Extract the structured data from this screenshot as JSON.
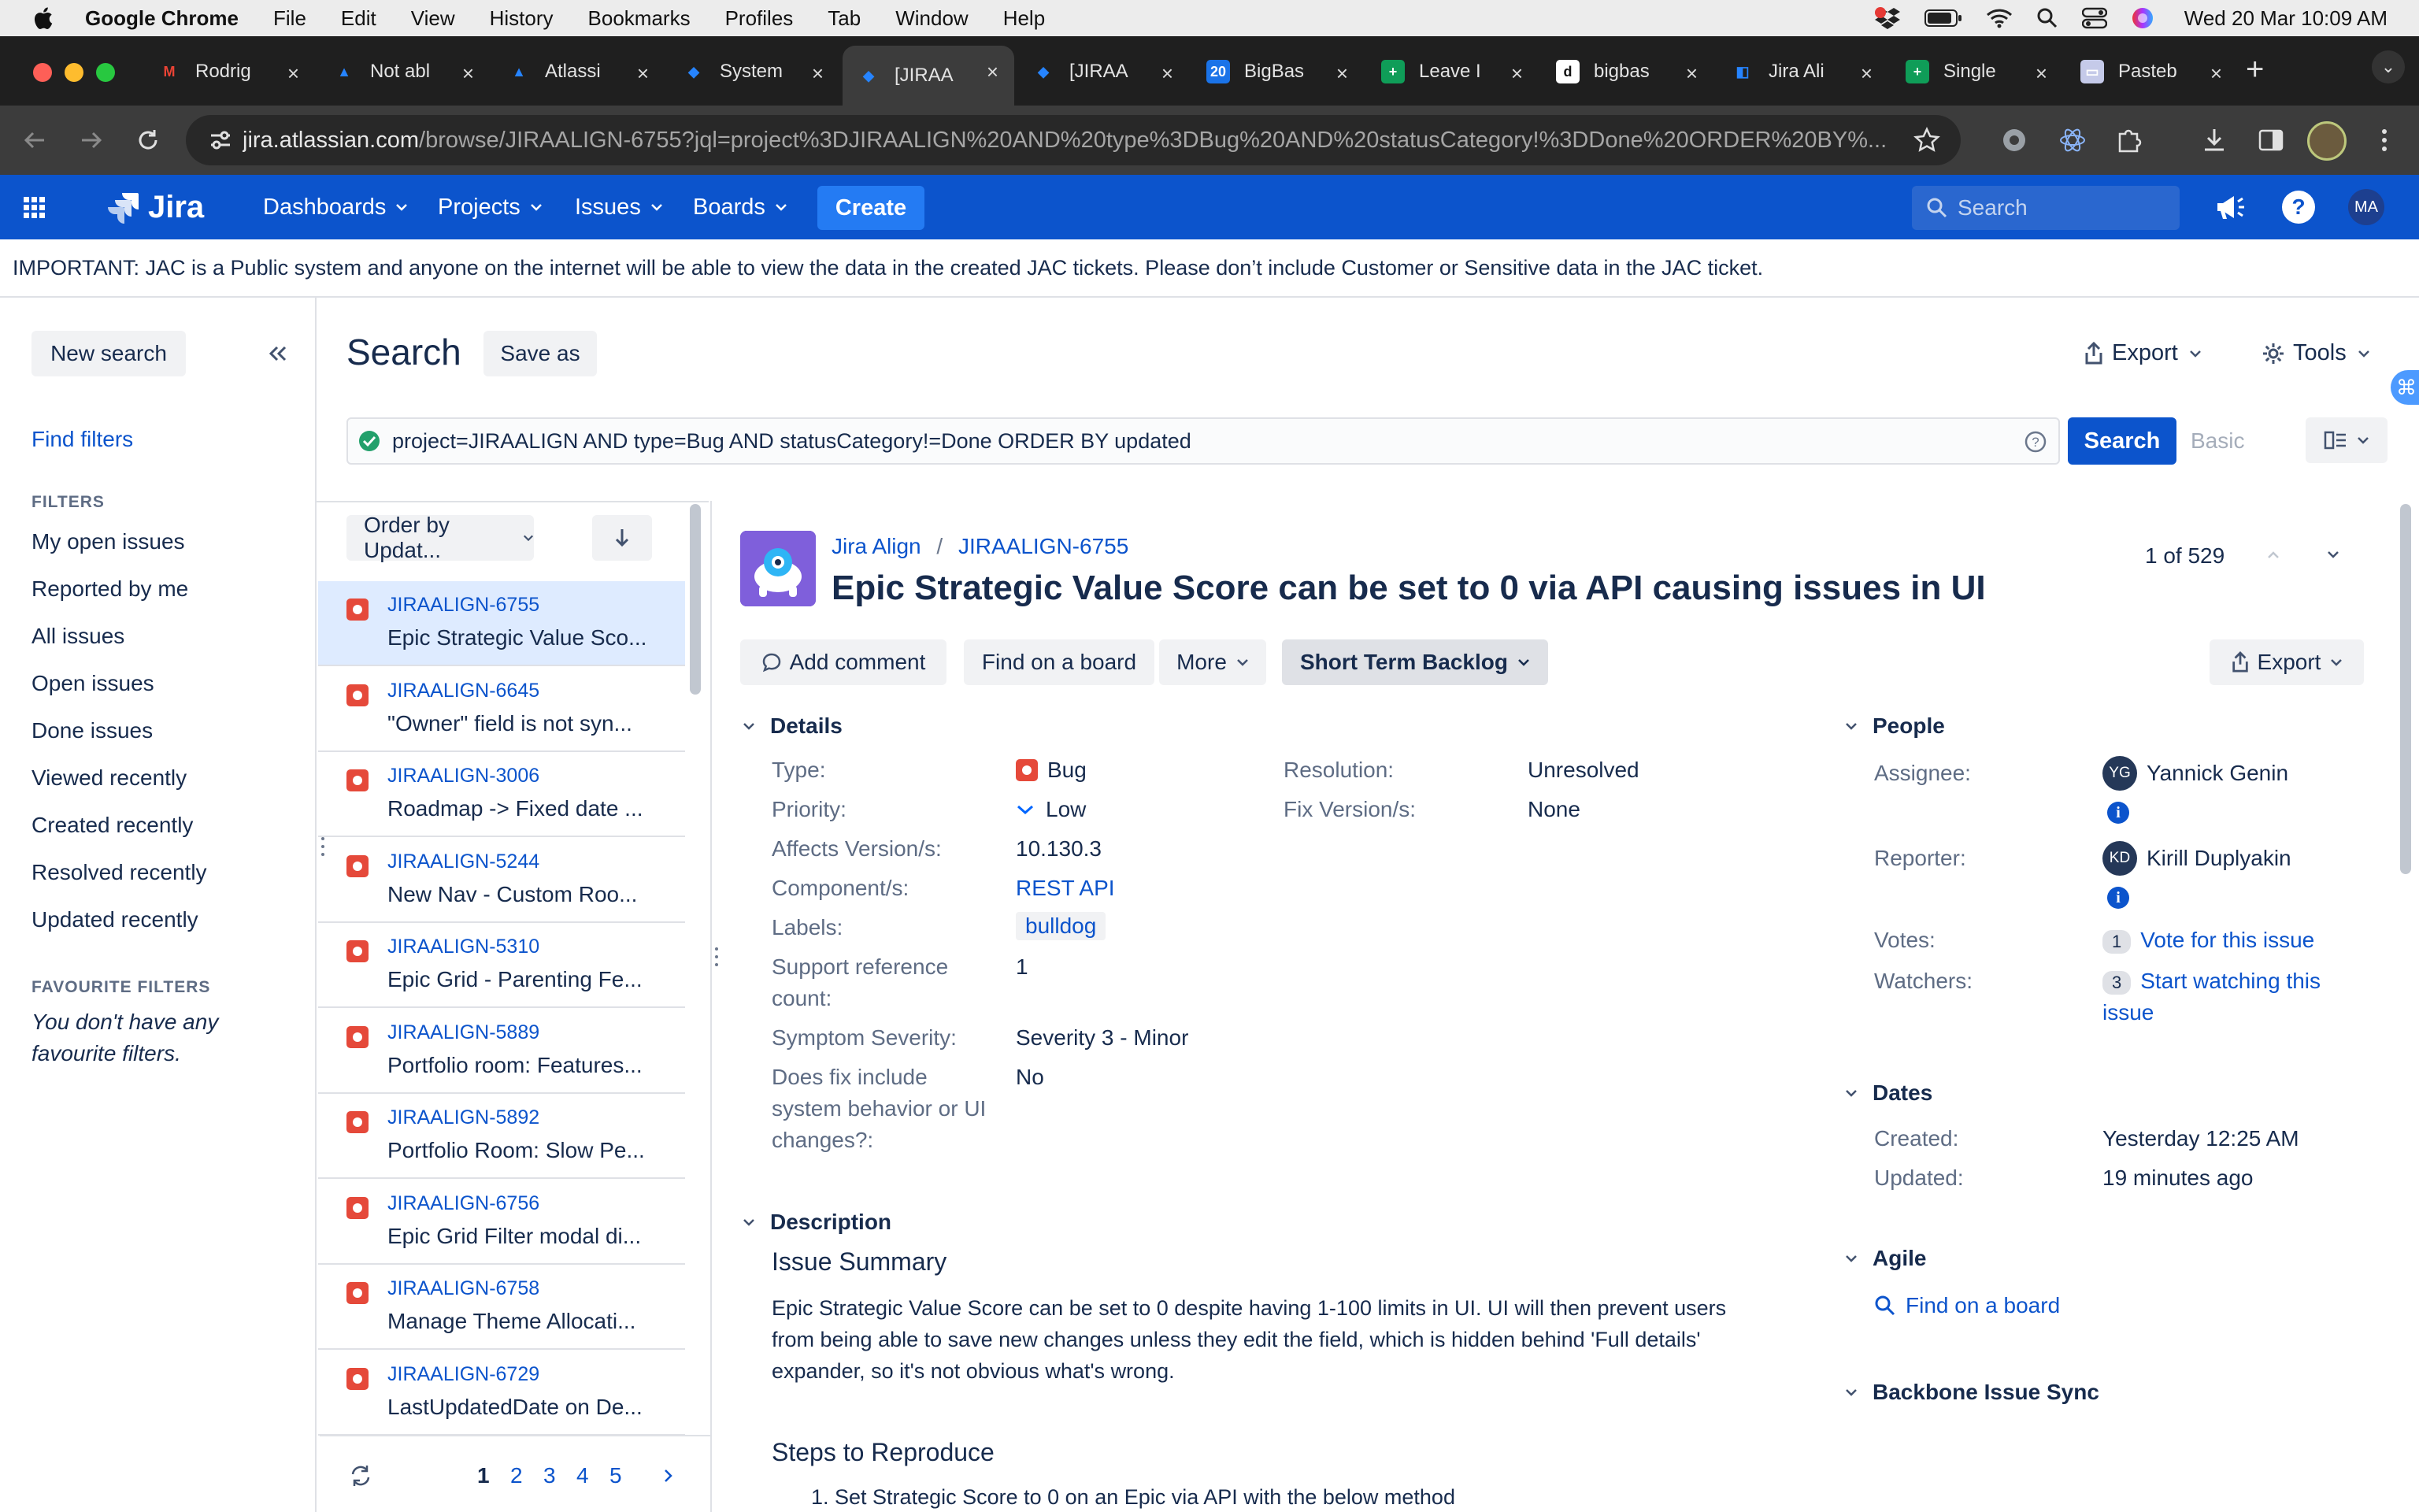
{
  "menubar": {
    "app": "Google Chrome",
    "items": [
      "File",
      "Edit",
      "View",
      "History",
      "Bookmarks",
      "Profiles",
      "Tab",
      "Window",
      "Help"
    ],
    "clock": "Wed 20 Mar  10:09 AM"
  },
  "tabs": [
    {
      "title": "Rodrig",
      "favicon": "gmail-icon",
      "color": "#ea4335",
      "glyph": "M"
    },
    {
      "title": "Not abl",
      "favicon": "atlassian-icon",
      "color": "#2684ff",
      "glyph": "▲"
    },
    {
      "title": "Atlassi",
      "favicon": "atlassian-icon",
      "color": "#2684ff",
      "glyph": "▲"
    },
    {
      "title": "System",
      "favicon": "jira-align-icon",
      "color": "#2684ff",
      "glyph": "◆"
    },
    {
      "title": "[JIRAA",
      "favicon": "jira-align-icon",
      "color": "#2684ff",
      "glyph": "◆"
    },
    {
      "title": "[JIRAA",
      "favicon": "jira-align-icon",
      "color": "#2684ff",
      "glyph": "◆"
    },
    {
      "title": "BigBas",
      "favicon": "calendar-icon",
      "color": "#1a73e8",
      "glyph": "20"
    },
    {
      "title": "Leave I",
      "favicon": "sheets-icon",
      "color": "#0f9d58",
      "glyph": "+"
    },
    {
      "title": "bigbas",
      "favicon": "d-icon",
      "color": "#ffffff",
      "glyph": "d"
    },
    {
      "title": "Jira Ali",
      "favicon": "jira-icon",
      "color": "#2684ff",
      "glyph": "◧"
    },
    {
      "title": "Single",
      "favicon": "sheets-icon",
      "color": "#0f9d58",
      "glyph": "+"
    },
    {
      "title": "Pasteb",
      "favicon": "pastebin-icon",
      "color": "#c5cae9",
      "glyph": "▭"
    }
  ],
  "browser": {
    "url_host": "jira.atlassian.com",
    "url_path": "/browse/JIRAALIGN-6755?jql=project%3DJIRAALIGN%20AND%20type%3DBug%20AND%20statusCategory!%3DDone%20ORDER%20BY%..."
  },
  "jira_nav": {
    "logo": "Jira",
    "items": [
      "Dashboards",
      "Projects",
      "Issues",
      "Boards"
    ],
    "create": "Create",
    "search_placeholder": "Search",
    "avatar": "MA"
  },
  "banner": "IMPORTANT: JAC is a Public system and anyone on the internet will be able to view the data in the created JAC tickets. Please don’t include Customer or Sensitive data in the JAC ticket.",
  "sidebar": {
    "new_search": "New search",
    "find_filters": "Find filters",
    "filters_heading": "FILTERS",
    "filters": [
      "My open issues",
      "Reported by me",
      "All issues",
      "Open issues",
      "Done issues",
      "Viewed recently",
      "Created recently",
      "Resolved recently",
      "Updated recently"
    ],
    "favourites_heading": "FAVOURITE FILTERS",
    "favourites_empty_1": "You don't have any",
    "favourites_empty_2": "favourite filters."
  },
  "search": {
    "title": "Search",
    "save_as": "Save as",
    "export": "Export",
    "tools": "Tools",
    "jql": "project=JIRAALIGN AND type=Bug AND statusCategory!=Done ORDER BY updated",
    "search_button": "Search",
    "basic": "Basic"
  },
  "list": {
    "order_by": "Order by Updat...",
    "issues": [
      {
        "key": "JIRAALIGN-6755",
        "summary": "Epic Strategic Value Sco..."
      },
      {
        "key": "JIRAALIGN-6645",
        "summary": "\"Owner\" field is not syn..."
      },
      {
        "key": "JIRAALIGN-3006",
        "summary": "Roadmap -> Fixed date ..."
      },
      {
        "key": "JIRAALIGN-5244",
        "summary": "New Nav - Custom Roo..."
      },
      {
        "key": "JIRAALIGN-5310",
        "summary": "Epic Grid - Parenting Fe..."
      },
      {
        "key": "JIRAALIGN-5889",
        "summary": "Portfolio room: Features..."
      },
      {
        "key": "JIRAALIGN-5892",
        "summary": "Portfolio Room: Slow Pe..."
      },
      {
        "key": "JIRAALIGN-6756",
        "summary": "Epic Grid Filter modal di..."
      },
      {
        "key": "JIRAALIGN-6758",
        "summary": "Manage Theme Allocati..."
      },
      {
        "key": "JIRAALIGN-6729",
        "summary": "LastUpdatedDate on De..."
      }
    ],
    "pages": [
      "1",
      "2",
      "3",
      "4",
      "5"
    ]
  },
  "issue": {
    "project": "Jira Align",
    "key": "JIRAALIGN-6755",
    "title": "Epic Strategic Value Score can be set to 0 via API causing issues in UI",
    "position": "1 of 529",
    "actions": {
      "add_comment": "Add comment",
      "find_board": "Find on a board",
      "more": "More",
      "status": "Short Term Backlog",
      "export": "Export"
    },
    "details_heading": "Details",
    "details": {
      "type_label": "Type:",
      "type": "Bug",
      "priority_label": "Priority:",
      "priority": "Low",
      "affects_label": "Affects Version/s:",
      "affects": "10.130.3",
      "component_label": "Component/s:",
      "component": "REST API",
      "labels_label": "Labels:",
      "labels": "bulldog",
      "support_label_1": "Support reference",
      "support_label_2": "count:",
      "support": "1",
      "severity_label": "Symptom Severity:",
      "severity": "Severity 3 - Minor",
      "fix_label_1": "Does fix include",
      "fix_label_2": "system behavior or UI",
      "fix_label_3": "changes?:",
      "fix": "No",
      "resolution_label": "Resolution:",
      "resolution": "Unresolved",
      "fixversion_label": "Fix Version/s:",
      "fixversion": "None"
    },
    "description_heading": "Description",
    "summary_heading": "Issue Summary",
    "summary_1": "Epic Strategic Value Score can be set to 0 despite having 1-100 limits in UI. UI will then prevent users",
    "summary_2": "from being able to save new changes unless they edit the field, which is hidden behind 'Full details'",
    "summary_3": "expander, so it's not obvious what's wrong.",
    "steps_heading": "Steps to Reproduce",
    "step_1": "1. Set Strategic Score to 0 on an Epic via API with the below method",
    "people_heading": "People",
    "people": {
      "assignee_label": "Assignee:",
      "assignee": "Yannick Genin",
      "assignee_initials": "YG",
      "reporter_label": "Reporter:",
      "reporter": "Kirill Duplyakin",
      "reporter_initials": "KD",
      "votes_label": "Votes:",
      "votes": "1",
      "vote_link": "Vote for this issue",
      "watchers_label": "Watchers:",
      "watchers": "3",
      "watch_link_1": "Start watching this",
      "watch_link_2": "issue"
    },
    "dates_heading": "Dates",
    "dates": {
      "created_label": "Created:",
      "created": "Yesterday 12:25 AM",
      "updated_label": "Updated:",
      "updated": "19 minutes ago"
    },
    "agile_heading": "Agile",
    "agile_link": "Find on a board",
    "backbone_heading": "Backbone Issue Sync"
  }
}
